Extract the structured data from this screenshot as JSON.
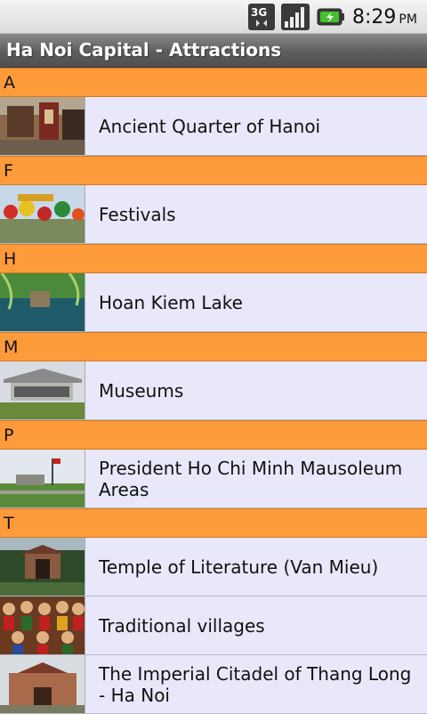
{
  "status_bar": {
    "network": "3G",
    "time": "8:29",
    "ampm": "PM"
  },
  "app": {
    "title": "Ha Noi Capital - Attractions"
  },
  "sections": [
    {
      "letter": "A",
      "items": [
        {
          "label": "Ancient Quarter of Hanoi"
        }
      ]
    },
    {
      "letter": "F",
      "items": [
        {
          "label": "Festivals"
        }
      ]
    },
    {
      "letter": "H",
      "items": [
        {
          "label": "Hoan Kiem Lake"
        }
      ]
    },
    {
      "letter": "M",
      "items": [
        {
          "label": "Museums"
        }
      ]
    },
    {
      "letter": "P",
      "items": [
        {
          "label": "President Ho Chi Minh Mausoleum Areas"
        }
      ]
    },
    {
      "letter": "T",
      "items": [
        {
          "label": "Temple of Literature (Van Mieu)"
        },
        {
          "label": "Traditional villages"
        },
        {
          "label": "The Imperial Citadel of Thang Long - Ha Noi"
        }
      ]
    }
  ],
  "colors": {
    "section_header": "#fd9b3b",
    "row_background": "#e8e8fa",
    "title_bar": "#5d5d5d"
  }
}
